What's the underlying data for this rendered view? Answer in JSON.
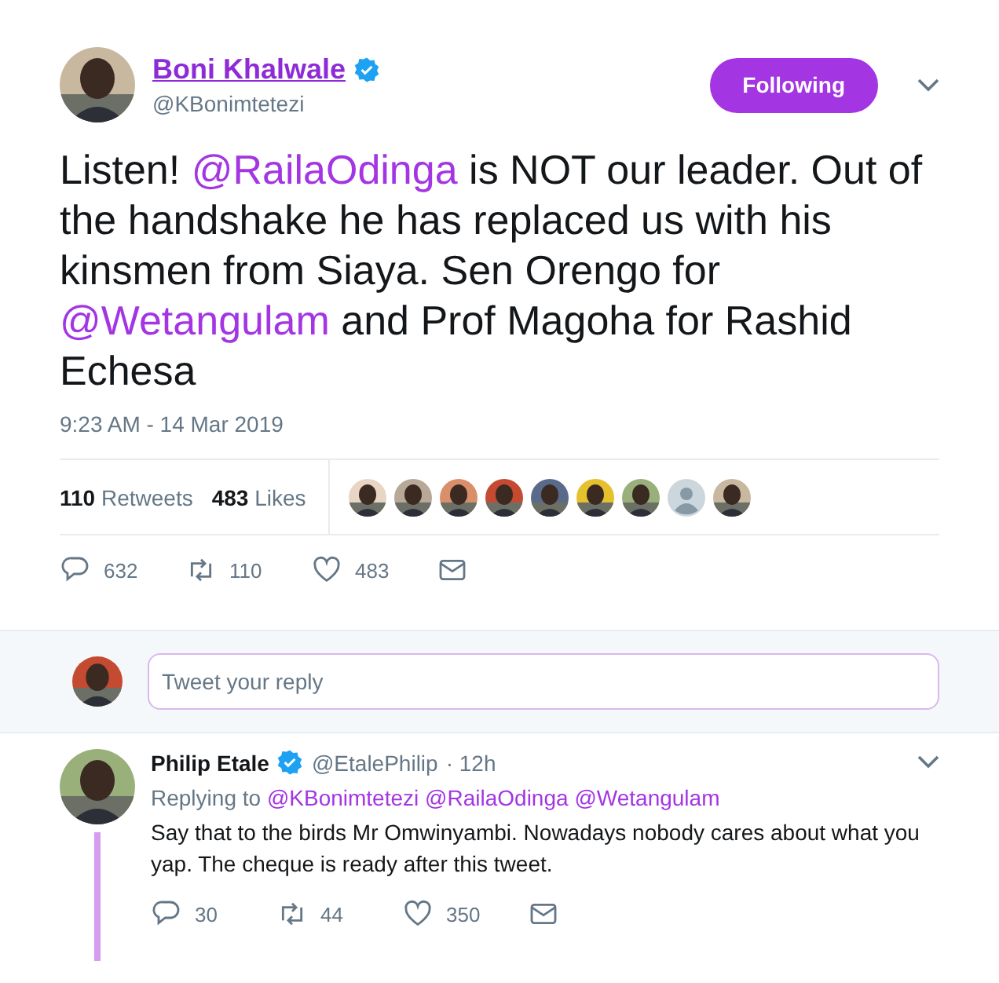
{
  "tweet": {
    "author": {
      "name": "Boni Khalwale",
      "verified": true,
      "handle": "@KBonimtetezi",
      "avatar": {
        "kind": "picture"
      }
    },
    "follow_button": {
      "label": "Following",
      "selected": true
    },
    "text": [
      {
        "kind": "text",
        "text": "Listen! "
      },
      {
        "kind": "mention",
        "text": "@RailaOdinga"
      },
      {
        "kind": "text",
        "text": " is NOT our leader. Out of the handshake he has replaced us with his kinsmen from Siaya. Sen Orengo for "
      },
      {
        "kind": "mention",
        "text": "@Wetangulam"
      },
      {
        "kind": "text",
        "text": " and Prof Magoha for Rashid Echesa"
      }
    ],
    "timestamp": "9:23 AM - 14 Mar 2019",
    "stats": [
      {
        "count": "110",
        "label": "Retweets"
      },
      {
        "count": "483",
        "label": "Likes"
      }
    ],
    "likers": [
      {
        "kind": "picture"
      },
      {
        "kind": "picture"
      },
      {
        "kind": "picture"
      },
      {
        "kind": "picture"
      },
      {
        "kind": "picture"
      },
      {
        "kind": "picture"
      },
      {
        "kind": "picture"
      },
      {
        "kind": "default"
      },
      {
        "kind": "picture"
      }
    ],
    "actions": [
      {
        "kind": "reply",
        "count": "632"
      },
      {
        "kind": "retweet",
        "count": "110"
      },
      {
        "kind": "like",
        "count": "483"
      },
      {
        "kind": "message"
      }
    ]
  },
  "reply_box": {
    "placeholder": "Tweet your reply"
  },
  "replies": [
    {
      "name": "Philip Etale",
      "verified": true,
      "handle": "@EtalePhilip",
      "time": "· 12h",
      "replying_label": "Replying to",
      "replying_to": [
        "@KBonimtetezi",
        "@RailaOdinga",
        "@Wetangulam"
      ],
      "text": "Say that to the birds Mr Omwinyambi. Nowadays nobody cares about what you yap. The cheque is ready after this tweet.",
      "thread_line": true,
      "actions": [
        {
          "kind": "reply",
          "count": "30"
        },
        {
          "kind": "retweet",
          "count": "44"
        },
        {
          "kind": "like",
          "count": "350"
        },
        {
          "kind": "message"
        }
      ]
    }
  ]
}
